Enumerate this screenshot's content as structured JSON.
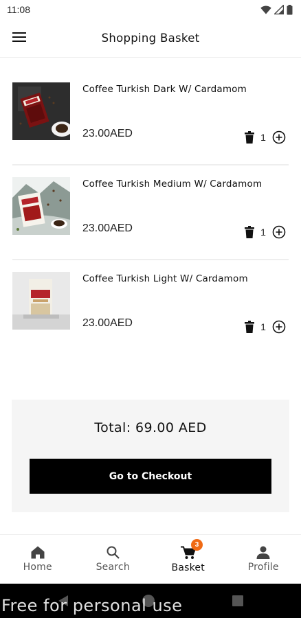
{
  "status_bar": {
    "time": "11:08",
    "icons": [
      "wifi-icon",
      "signal-icon",
      "battery-icon"
    ]
  },
  "app_bar": {
    "title": "Shopping Basket",
    "menu_icon": "hamburger-menu-icon"
  },
  "items": [
    {
      "name": "Coffee Turkish Dark W/ Cardamom",
      "price": "23.00AED",
      "quantity": "1",
      "delete_icon": "trash-icon",
      "add_icon": "plus-circle-icon"
    },
    {
      "name": "Coffee Turkish Medium W/ Cardamom",
      "price": "23.00AED",
      "quantity": "1",
      "delete_icon": "trash-icon",
      "add_icon": "plus-circle-icon"
    },
    {
      "name": "Coffee Turkish Light W/ Cardamom",
      "price": "23.00AED",
      "quantity": "1",
      "delete_icon": "trash-icon",
      "add_icon": "plus-circle-icon"
    }
  ],
  "summary": {
    "total_label": "Total:",
    "total_value": "69.00 AED",
    "checkout_label": "Go to Checkout"
  },
  "bottom_nav": {
    "items": [
      {
        "label": "Home",
        "icon": "home-icon"
      },
      {
        "label": "Search",
        "icon": "search-icon"
      },
      {
        "label": "Basket",
        "icon": "cart-icon",
        "badge": "3",
        "active": true
      },
      {
        "label": "Profile",
        "icon": "person-icon"
      }
    ]
  },
  "watermark": "Free for personal use",
  "colors": {
    "accent_badge": "#f06a14",
    "button": "#000000",
    "summary_bg": "#f5f5f5"
  }
}
